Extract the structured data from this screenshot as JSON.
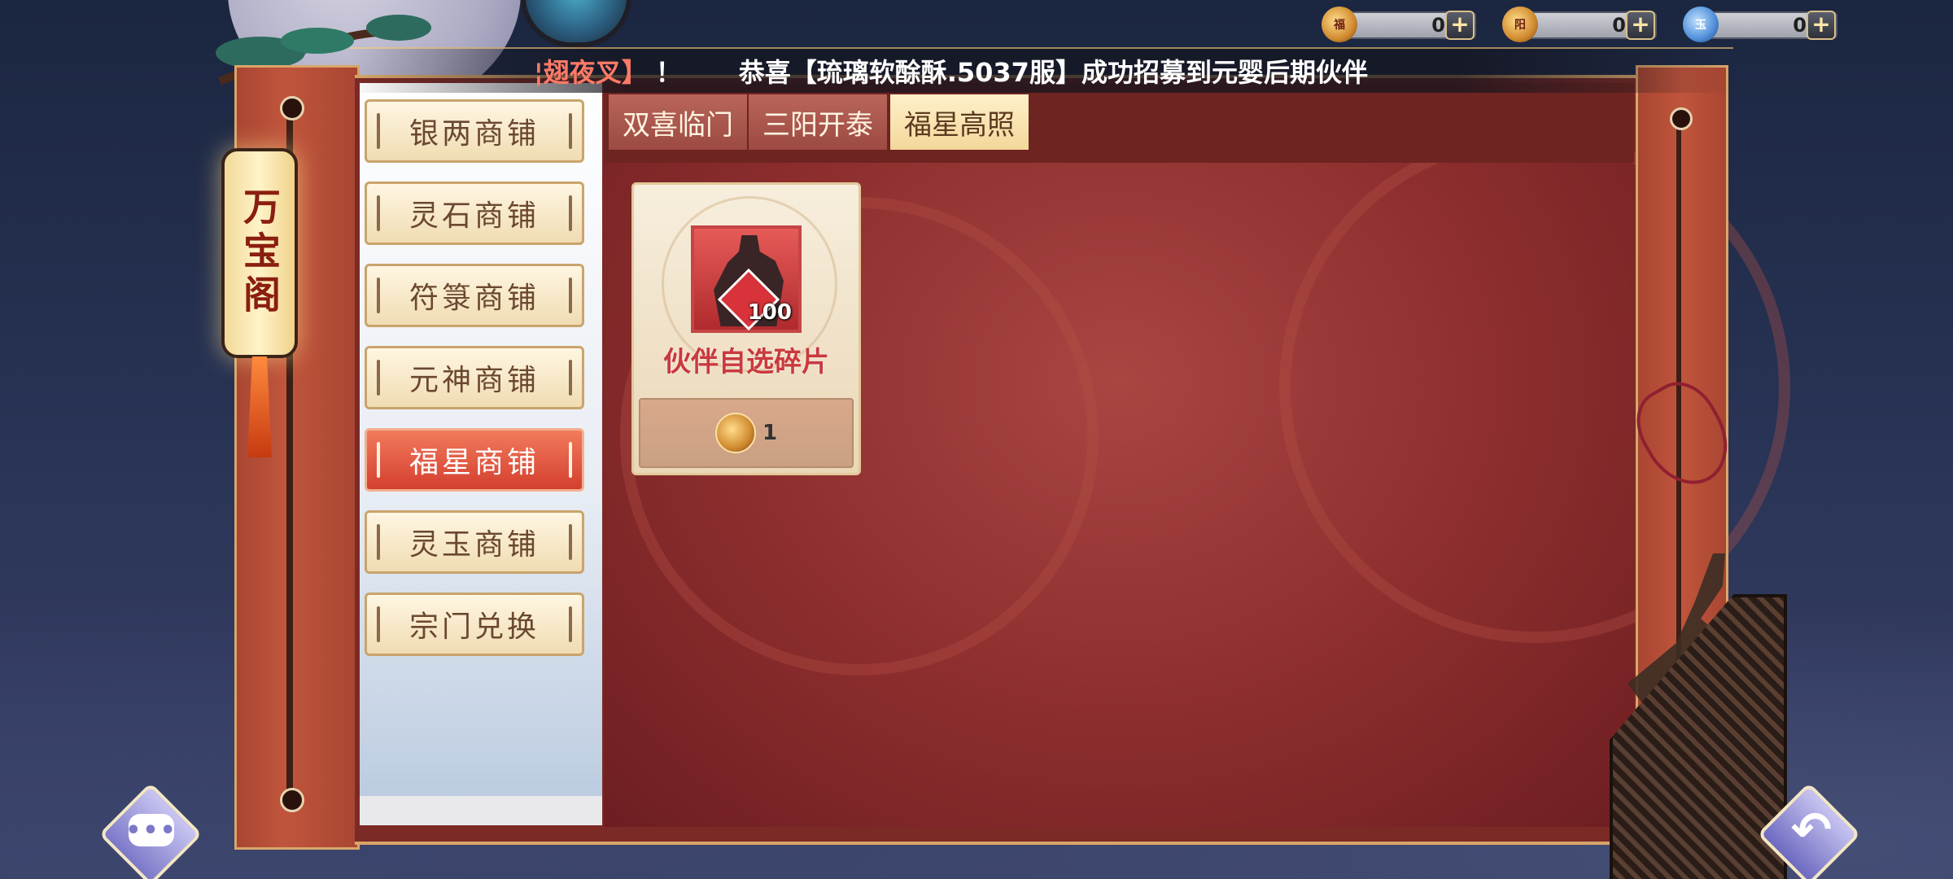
{
  "currencies": [
    {
      "icon": "fuxing-coin-icon",
      "amount": "0",
      "add_label": "+"
    },
    {
      "icon": "sanyang-coin-icon",
      "amount": "0",
      "add_label": "+"
    },
    {
      "icon": "lingyu-coin-icon",
      "amount": "0",
      "add_label": "+"
    }
  ],
  "marquee": {
    "first": "¦翅夜叉】",
    "excl": "！",
    "message": "恭喜【琉璃软酴酥.5037服】成功招募到元婴后期伙伴"
  },
  "lantern": {
    "title": "万宝阁"
  },
  "shop_menu": [
    {
      "label": "银两商铺",
      "active": false
    },
    {
      "label": "灵石商铺",
      "active": false
    },
    {
      "label": "符箓商铺",
      "active": false
    },
    {
      "label": "元神商铺",
      "active": false
    },
    {
      "label": "福星商铺",
      "active": true
    },
    {
      "label": "灵玉商铺",
      "active": false
    },
    {
      "label": "宗门兑换",
      "active": false
    }
  ],
  "tabs": [
    {
      "label": "双喜临门",
      "active": false
    },
    {
      "label": "三阳开泰",
      "active": false
    },
    {
      "label": "福星高照",
      "active": true
    }
  ],
  "items": [
    {
      "name": "伙伴自选碎片",
      "count": "100",
      "price": "1",
      "price_icon": "fuxing-coin-icon"
    }
  ],
  "buttons": {
    "chat_icon": "chat-icon",
    "chat_glyph": "•••",
    "back_icon": "back-arrow-icon",
    "back_glyph": "↶"
  },
  "colors": {
    "board": "#7b2a26",
    "active_menu": "#d43f2f",
    "active_tab": "#f3d79a",
    "item_name": "#c93a3e"
  }
}
